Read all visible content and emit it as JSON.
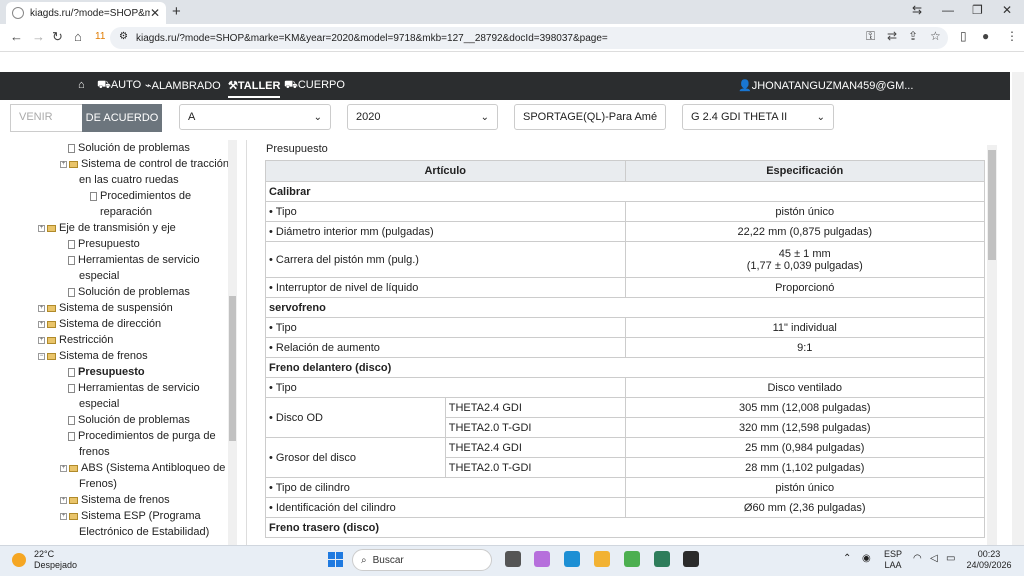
{
  "browser": {
    "tab_title": "kiagds.ru/?mode=SHOP&marke=",
    "tab_close": "✕",
    "new_tab": "+",
    "url": "kiagds.ru/?mode=SHOP&marke=KM&year=2020&model=9718&mkb=127__28792&docId=398037&page=",
    "badge": "11"
  },
  "nav": {
    "auto": "AUTO",
    "wiring": "ALAMBRADO",
    "shop": "TALLER",
    "body": "CUERPO",
    "user": "JHONATANGUZMAN459@GM..."
  },
  "filters": {
    "vin_placeholder": "VENIR",
    "agree_button": "DE ACUERDO",
    "make": "A",
    "year": "2020",
    "model": "SPORTAGE(QL)-Para Amé",
    "engine": "G 2.4 GDI THETA II"
  },
  "tree": [
    {
      "label": "Solución de problemas"
    },
    {
      "label": "Sistema de control de tracción"
    },
    {
      "label": "en las cuatro ruedas"
    },
    {
      "label": "Procedimientos de"
    },
    {
      "label": "reparación"
    },
    {
      "label": "Eje de transmisión y eje"
    },
    {
      "label": "Presupuesto"
    },
    {
      "label": "Herramientas de servicio"
    },
    {
      "label": "especial"
    },
    {
      "label": "Solución de problemas"
    },
    {
      "label": "Sistema de suspensión"
    },
    {
      "label": "Sistema de dirección"
    },
    {
      "label": "Restricción"
    },
    {
      "label": "Sistema de frenos"
    },
    {
      "label": "Presupuesto"
    },
    {
      "label": "Herramientas de servicio"
    },
    {
      "label": "especial"
    },
    {
      "label": "Solución de problemas"
    },
    {
      "label": "Procedimientos de purga de"
    },
    {
      "label": "frenos"
    },
    {
      "label": "ABS (Sistema Antibloqueo de"
    },
    {
      "label": "Frenos)"
    },
    {
      "label": "Sistema de frenos"
    },
    {
      "label": "Sistema ESP (Programa"
    },
    {
      "label": "Electrónico de Estabilidad)"
    }
  ],
  "content": {
    "breadcrumb": "Presupuesto",
    "col_article": "Artículo",
    "col_spec": "Especificación",
    "s1": "Calibrar",
    "r_tipo": "• Tipo",
    "r_tipo_v": "pistón único",
    "r_diam": "• Diámetro interior mm (pulgadas)",
    "r_diam_v": "22,22 mm (0,875 pulgadas)",
    "r_carrera": "• Carrera del pistón mm (pulg.)",
    "r_carrera_v1": "45 ± 1 mm",
    "r_carrera_v2": "(1,77 ± 0,039 pulgadas)",
    "r_inter": "• Interruptor de nivel de líquido",
    "r_inter_v": "Proporcionó",
    "s2": "servofreno",
    "r_sf_tipo": "• Tipo",
    "r_sf_tipo_v": "11\" individual",
    "r_rel": "• Relación de aumento",
    "r_rel_v": "9:1",
    "s3": "Freno delantero (disco)",
    "r_fd_tipo": "• Tipo",
    "r_fd_tipo_v": "Disco ventilado",
    "r_od": "• Disco OD",
    "eng1": "THETA2.4 GDI",
    "eng2": "THETA2.0 T-GDI",
    "r_od_v1": "305 mm (12,008 pulgadas)",
    "r_od_v2": "320 mm (12,598 pulgadas)",
    "r_gros": "• Grosor del disco",
    "r_gros_v1": "25 mm (0,984 pulgadas)",
    "r_gros_v2": "28 mm (1,102 pulgadas)",
    "r_cil": "• Tipo de cilindro",
    "r_cil_v": "pistón único",
    "r_id": "• Identificación del cilindro",
    "r_id_v": "Ø60 mm (2,36 pulgadas)",
    "s4": "Freno trasero (disco)"
  },
  "taskbar": {
    "temp": "22°C",
    "weather": "Despejado",
    "search": "Buscar",
    "lang1": "ESP",
    "lang2": "LAA",
    "time": "00:23",
    "date": "24/09/2026"
  }
}
